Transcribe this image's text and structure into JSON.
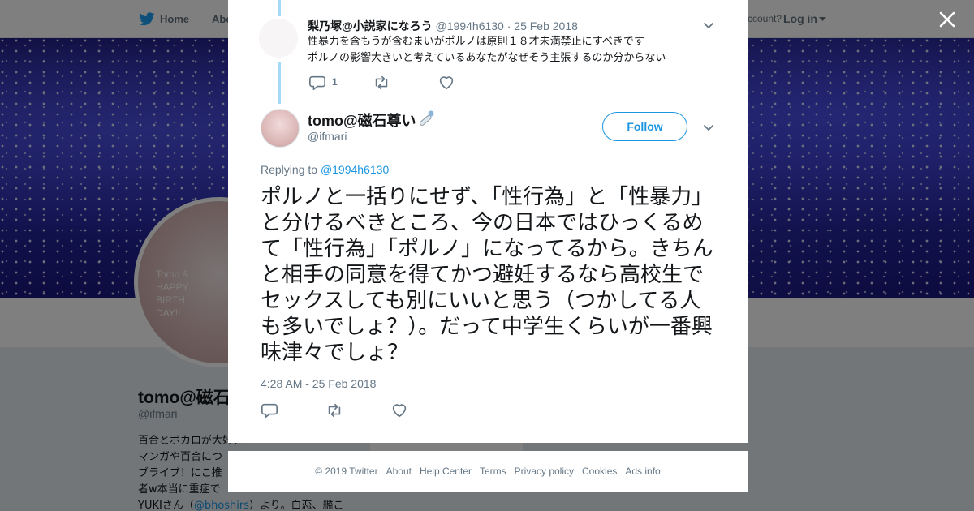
{
  "topbar": {
    "home": "Home",
    "about": "Abo",
    "have_account": "ccount?",
    "login": "Log in"
  },
  "profile": {
    "avatar_text": [
      "Tomo &",
      "HAPPY",
      "BIRTH",
      "DAY!!"
    ],
    "name": "tomo@磁石",
    "handle": "@ifmari",
    "bio_lines": [
      "百合とボカロが大好き",
      "マンガや百合につ",
      "ブライブ！にこ推",
      "者w本当に重症で"
    ],
    "bio_last_prefix": "YUKIさん（",
    "bio_last_mention": "@bhoshirs",
    "bio_last_suffix": "）より。白恋、艦こ"
  },
  "parent_tweet": {
    "name": "梨乃塚@小説家になろう",
    "handle": "@1994h6130",
    "separator": "·",
    "date": "25 Feb 2018",
    "text_lines": [
      "性暴力を含もうが含むまいがポルノは原則１８才未満禁止にすべきです",
      "ポルノの影響大きいと考えているあなたがなぜそう主張するのか分からない"
    ],
    "reply_count": "1"
  },
  "main_tweet": {
    "name": "tomo@磁石尊い",
    "emoji": "magnet-emoji",
    "handle": "@ifmari",
    "follow_label": "Follow",
    "replying_label": "Replying to",
    "replying_handle": "@1994h6130",
    "text": "ポルノと一括りにせず、「性行為」と「性暴力」と分けるべきところ、今の日本ではひっくるめて「性行為」「ポルノ」になってるから。きちんと相手の同意を得てかつ避妊するなら高校生でセックスしても別にいいと思う（つかしてる人も多いでしょ？）。だって中学生くらいが一番興味津々でしょ？",
    "timestamp": "4:28 AM - 25 Feb 2018"
  },
  "footer": {
    "copyright": "© 2019 Twitter",
    "links": [
      "About",
      "Help Center",
      "Terms",
      "Privacy policy",
      "Cookies",
      "Ads info"
    ]
  },
  "colors": {
    "twitter_blue": "#1b95e0",
    "thread_line": "#a4d9f9",
    "text_primary": "#14171a",
    "text_secondary": "#657786",
    "overlay": "rgba(0,0,0,0.5)"
  }
}
